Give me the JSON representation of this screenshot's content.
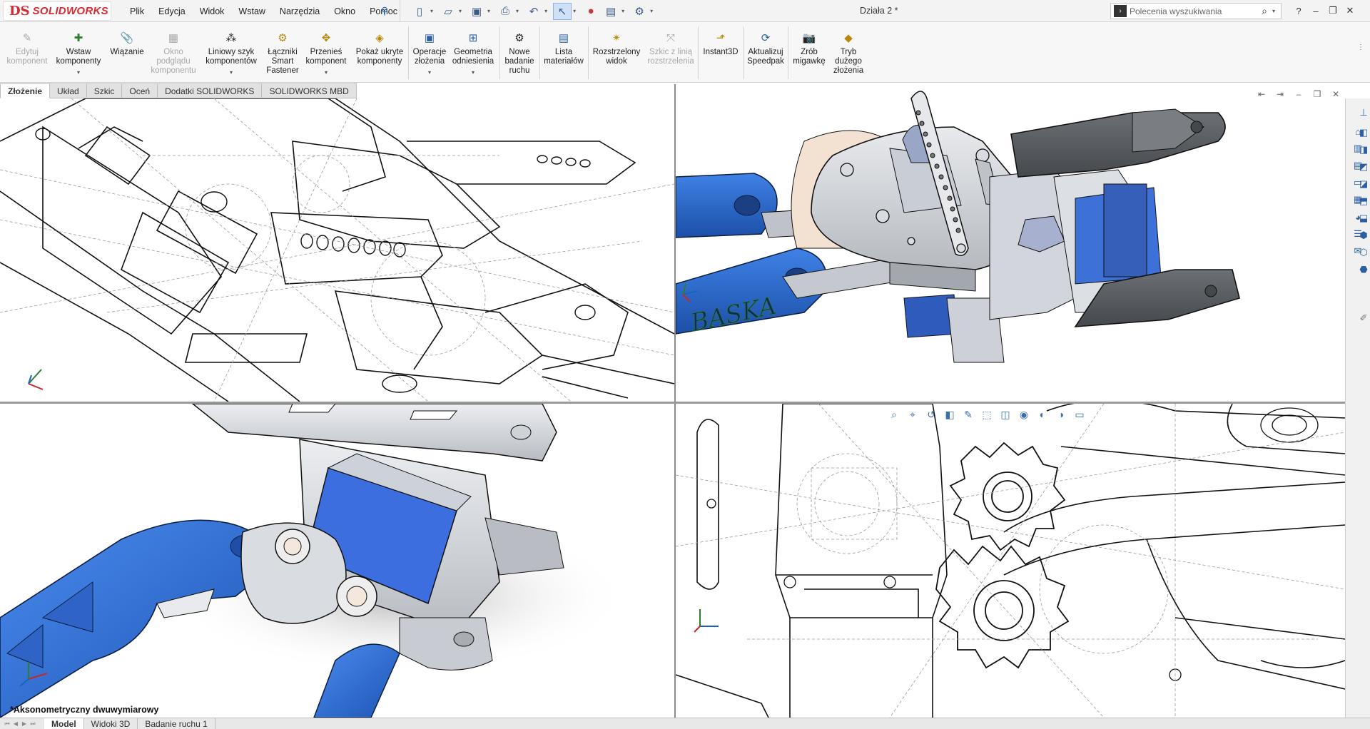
{
  "app": {
    "brand": "SOLIDWORKS",
    "brand_mark": "DS",
    "document_title": "Działa 2 *"
  },
  "menu": [
    "Plik",
    "Edycja",
    "Widok",
    "Wstaw",
    "Narzędzia",
    "Okno",
    "Pomoc"
  ],
  "search": {
    "placeholder": "Polecenia wyszukiwania"
  },
  "ribbon": [
    {
      "label": "Edytuj komponent",
      "enabled": false,
      "icon": "edit-component-icon"
    },
    {
      "label": "Wstaw komponenty",
      "enabled": true,
      "icon": "insert-components-icon"
    },
    {
      "label": "Wiązanie",
      "enabled": true,
      "icon": "mate-icon"
    },
    {
      "label": "Okno podglądu komponentu",
      "enabled": false,
      "icon": "component-preview-icon"
    },
    {
      "label": "Liniowy szyk komponentów",
      "enabled": true,
      "icon": "linear-pattern-icon"
    },
    {
      "label": "Łączniki Smart Fastener",
      "enabled": true,
      "icon": "smart-fasteners-icon"
    },
    {
      "label": "Przenieś komponent",
      "enabled": true,
      "icon": "move-component-icon"
    },
    {
      "label": "Pokaż ukryte komponenty",
      "enabled": true,
      "icon": "show-hidden-icon"
    },
    {
      "label": "Operacje złożenia",
      "enabled": true,
      "icon": "assembly-features-icon"
    },
    {
      "label": "Geometria odniesienia",
      "enabled": true,
      "icon": "reference-geometry-icon"
    },
    {
      "label": "Nowe badanie ruchu",
      "enabled": true,
      "icon": "motion-study-icon"
    },
    {
      "label": "Lista materiałów",
      "enabled": true,
      "icon": "bill-of-materials-icon"
    },
    {
      "label": "Rozstrzelony widok",
      "enabled": true,
      "icon": "exploded-view-icon"
    },
    {
      "label": "Szkic z linią rozstrzelenia",
      "enabled": false,
      "icon": "explode-line-sketch-icon"
    },
    {
      "label": "Instant3D",
      "enabled": true,
      "icon": "instant3d-icon"
    },
    {
      "label": "Aktualizuj Speedpak",
      "enabled": true,
      "icon": "speedpak-icon"
    },
    {
      "label": "Zrób migawkę",
      "enabled": true,
      "icon": "snapshot-icon"
    },
    {
      "label": "Tryb dużego złożenia",
      "enabled": true,
      "icon": "large-assembly-icon"
    }
  ],
  "tabs": [
    "Złożenie",
    "Układ",
    "Szkic",
    "Oceń",
    "Dodatki SOLIDWORKS",
    "SOLIDWORKS MBD"
  ],
  "active_tab": "Złożenie",
  "viewport": {
    "view_orientation_label": "*Aksonometryczny dwuwymiarowy",
    "engraved_text": "BASKA",
    "colors": {
      "blue_part": "#2f6fd6",
      "dark_part": "#5a5d61",
      "light_part": "#d6d9de",
      "edges": "#111111"
    }
  },
  "bottom_tabs": [
    "Model",
    "Widoki 3D",
    "Badanie ruchu 1"
  ],
  "active_bottom_tab": "Model"
}
